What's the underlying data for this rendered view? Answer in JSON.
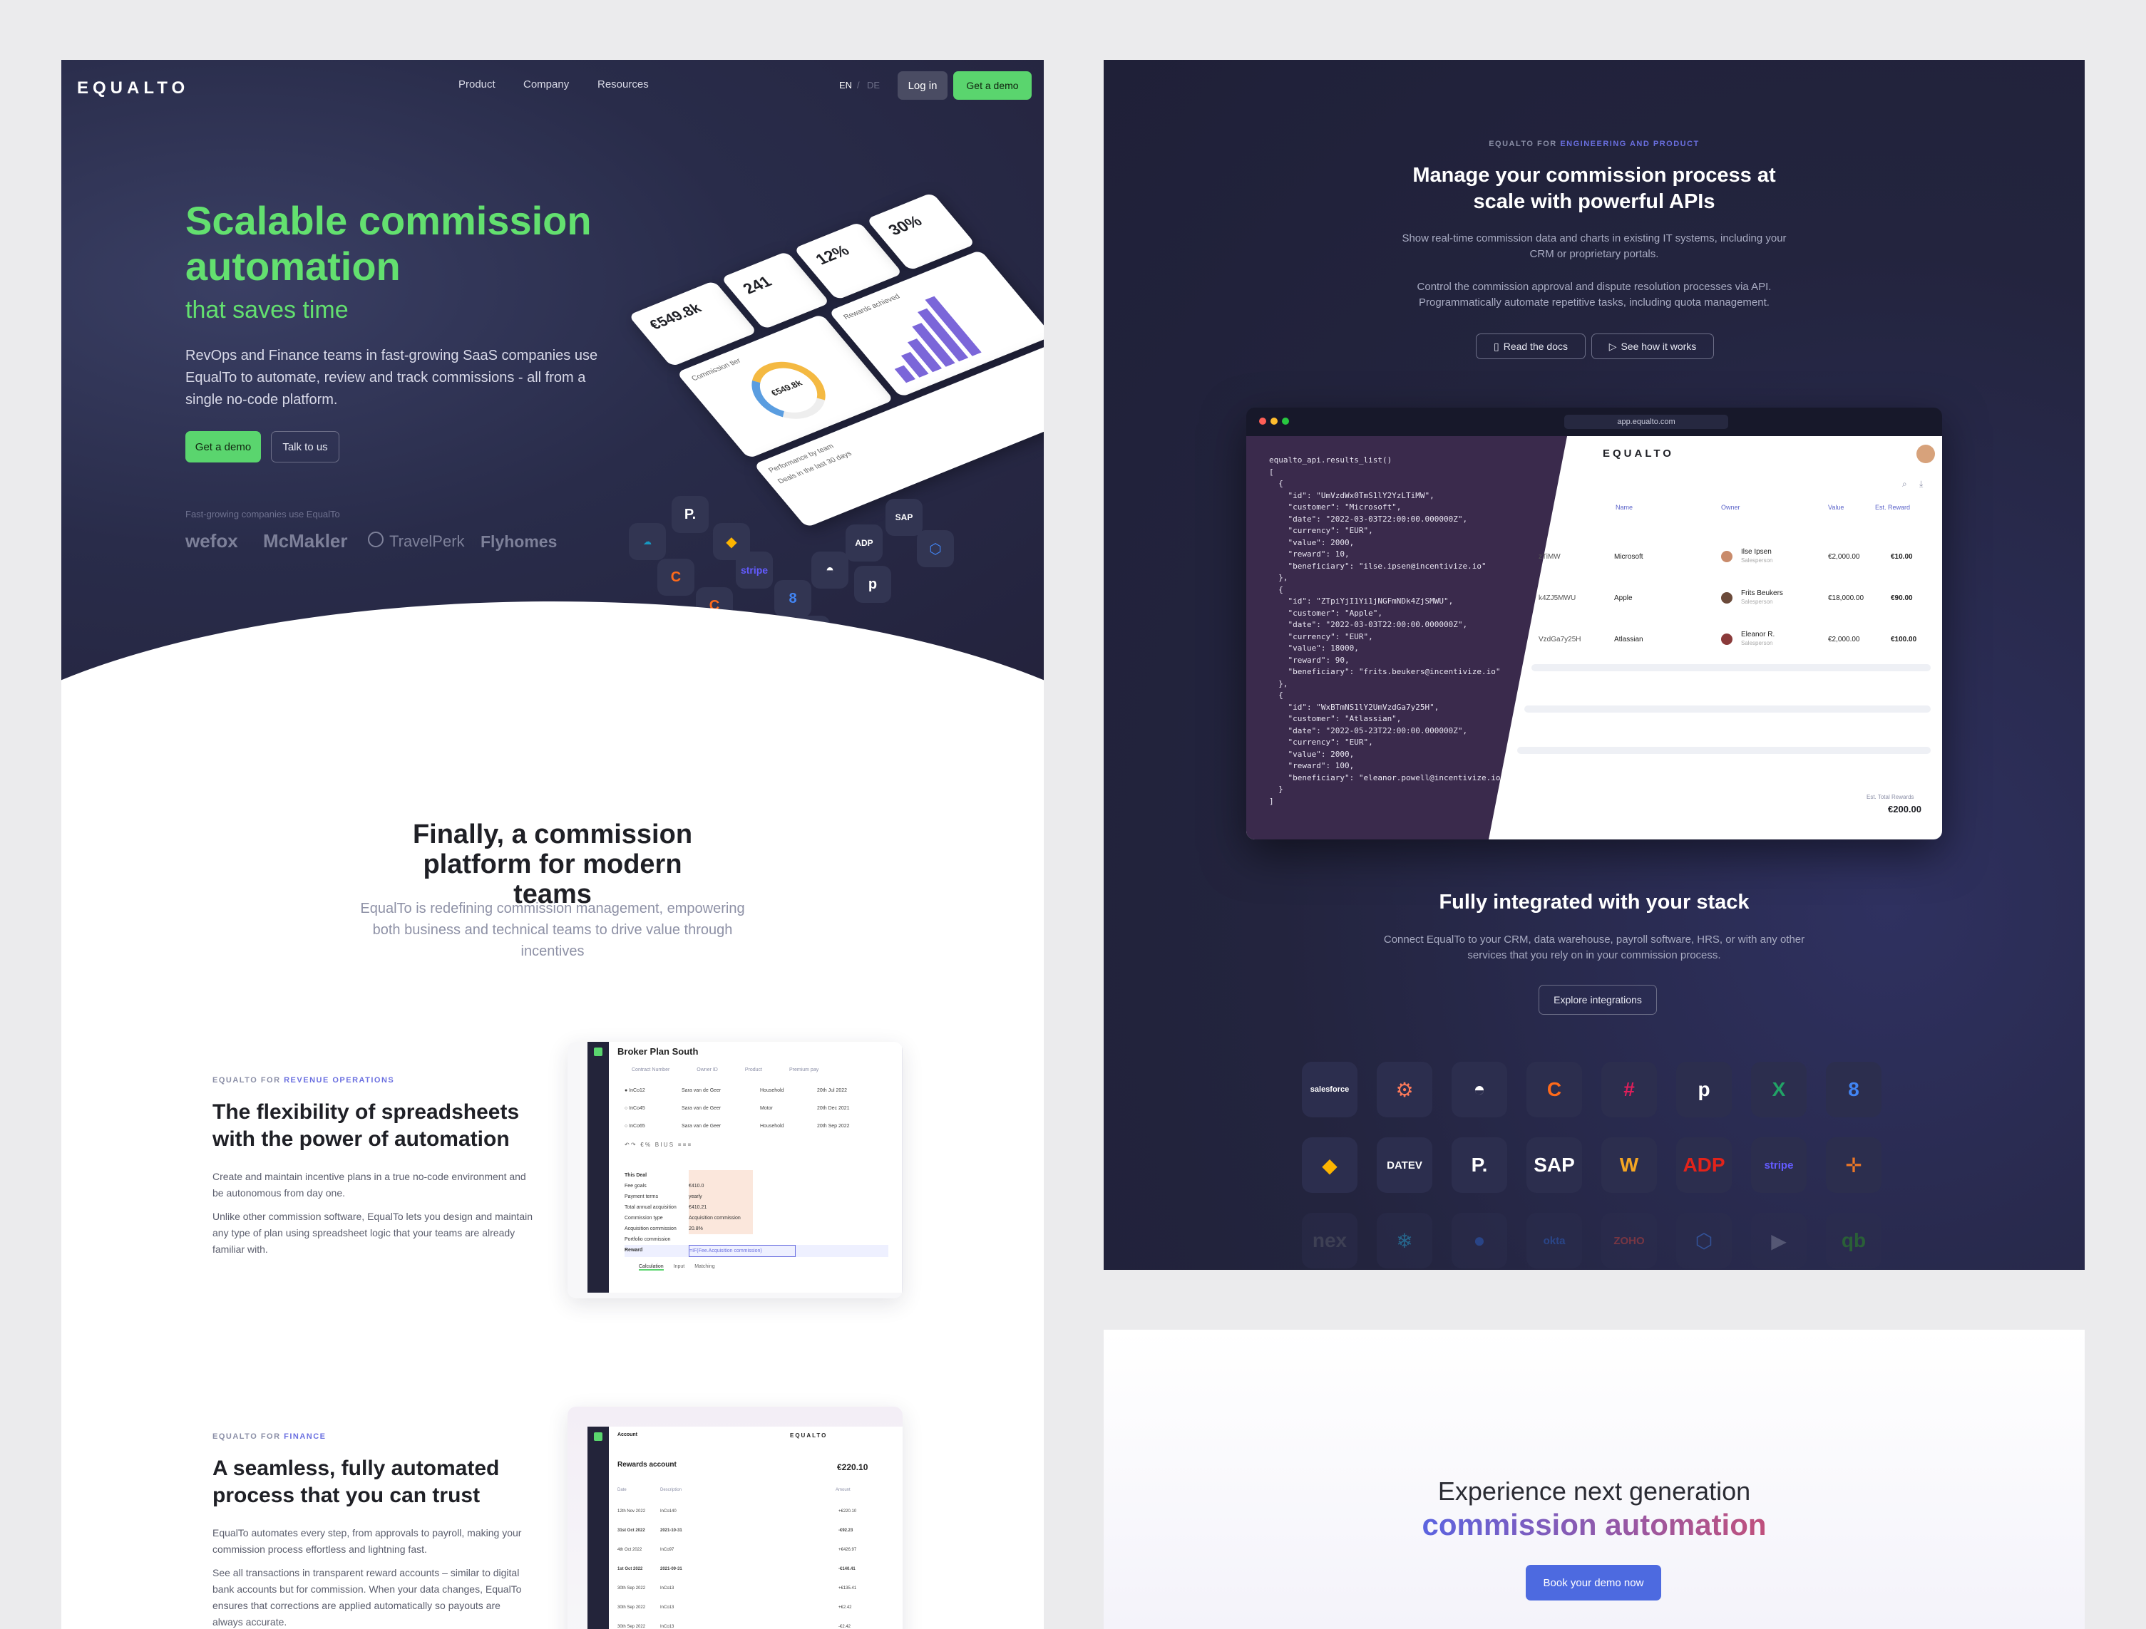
{
  "colors": {
    "accent_green": "#5ad56e",
    "hero_bg": "#292c4a",
    "purple": "#6a6fe0"
  },
  "nav": {
    "logo": "EQUALTO",
    "links": [
      "Product",
      "Company",
      "Resources"
    ],
    "lang_en": "EN",
    "lang_sep": "/",
    "lang_de": "DE",
    "login": "Log in",
    "demo": "Get a demo"
  },
  "hero": {
    "title": "Scalable commission automation",
    "subtitle": "that saves time",
    "description": "RevOps and Finance teams in fast-growing SaaS companies use EqualTo to automate, review and track commissions - all from a single no-code platform.",
    "cta_primary": "Get a demo",
    "cta_secondary": "Talk to us",
    "logos_label": "Fast-growing companies use EqualTo",
    "logos": [
      "wefox",
      "McMakler",
      "TravelPerk",
      "Flyhomes"
    ]
  },
  "dashboard": {
    "stat1": "€549.8k",
    "stat2": "241",
    "stat3": "12%",
    "stat4": "30%",
    "gauge_value": "€549.8k",
    "label_commission": "Commission tier",
    "label_rewards": "Rewards achieved",
    "label_deals": "Deals in the last 30 days",
    "label_performance": "Performance by team"
  },
  "modern": {
    "title": "Finally, a commission platform for modern teams",
    "text": "EqualTo is redefining commission management, empowering both business and technical teams to drive value through incentives"
  },
  "revops": {
    "eyebrow_prefix": "EQUALTO FOR",
    "eyebrow_highlight": "REVENUE OPERATIONS",
    "title": "The flexibility of spreadsheets with the power of automation",
    "p1": "Create and maintain incentive plans in a true no-code environment and be autonomous from day one.",
    "p2": "Unlike other commission software, EqualTo lets you design and maintain any type of plan using spreadsheet logic that your teams are already familiar with.",
    "shot_title": "Broker Plan South",
    "shot_cols": [
      "Contract Number",
      "Owner ID",
      "Product",
      "Premium pay"
    ],
    "shot_rows": [
      [
        "InCo12",
        "Sara van de Geer",
        "Household",
        "20th Jul 2022"
      ],
      [
        "InCo45",
        "Sara van de Geer",
        "Motor",
        "20th Dec 2021"
      ],
      [
        "InCo65",
        "Sara van de Geer",
        "Household",
        "20th Sep 2022"
      ]
    ],
    "sheet_rows": [
      "This Deal",
      "Fee goals",
      "Payment terms",
      "Total annual acquisition",
      "Commission type",
      "Acquisition commission",
      "Portfolio commission",
      "Reward"
    ],
    "sheet_vals": [
      "",
      "€410.0",
      "yearly",
      "€410.21",
      "Acquisition commission",
      "20.8%",
      "",
      "=IF(Fee.Acquisition commission)"
    ],
    "sheet_tabs": [
      "Calculation",
      "Input",
      "Matching"
    ]
  },
  "finance": {
    "eyebrow_prefix": "EQUALTO FOR",
    "eyebrow_highlight": "FINANCE",
    "title": "A seamless, fully automated process that you can trust",
    "p1": "EqualTo automates every step, from approvals to payroll, making your commission process effortless and lightning fast.",
    "p2": "See all transactions in transparent reward accounts – similar to digital bank accounts but for commission. When your data changes, EqualTo ensures that corrections are applied automatically so payouts are always accurate.",
    "shot_header": "Account",
    "shot_title": "Rewards account",
    "shot_total": "€220.10",
    "shot_cols": [
      "Date",
      "Description",
      "Amount"
    ],
    "shot_rows": [
      [
        "12th Nov 2022",
        "InCo140",
        "+€220.10"
      ],
      [
        "31st Oct 2022",
        "2021-10-31",
        "-€92.23"
      ],
      [
        "4th Oct 2022",
        "InCo97",
        "+€426.97"
      ],
      [
        "1st Oct 2022",
        "2021-09-31",
        "-€140.41"
      ],
      [
        "30th Sep 2022",
        "InCo13",
        "+€135.41"
      ],
      [
        "30th Sep 2022",
        "InCo13",
        "+€2.42"
      ],
      [
        "30th Sep 2022",
        "InCo13",
        "-€2.42"
      ]
    ]
  },
  "api": {
    "eyebrow_prefix": "EQUALTO FOR",
    "eyebrow_highlight": "ENGINEERING AND PRODUCT",
    "title": "Manage your commission process at scale with powerful APIs",
    "p1": "Show real-time commission data and charts in existing IT systems, including your CRM or proprietary portals.",
    "p2": "Control the commission approval and dispute resolution processes via API. Programmatically automate repetitive tasks, including quota management.",
    "btn_docs": "Read the docs",
    "btn_how": "See how it works",
    "url": "app.equalto.com",
    "code": "equalto_api.results_list()\n[\n  {\n    \"id\": \"UmVzdWx0TmS1lY2YzLTiMW\",\n    \"customer\": \"Microsoft\",\n    \"date\": \"2022-03-03T22:00:00.000000Z\",\n    \"currency\": \"EUR\",\n    \"value\": 2000,\n    \"reward\": 10,\n    \"beneficiary\": \"ilse.ipsen@incentivize.io\"\n  },\n  {\n    \"id\": \"ZTpiYjI1Yi1jNGFmNDk4ZjSMWU\",\n    \"customer\": \"Apple\",\n    \"date\": \"2022-03-03T22:00:00.000000Z\",\n    \"currency\": \"EUR\",\n    \"value\": 18000,\n    \"reward\": 90,\n    \"beneficiary\": \"frits.beukers@incentivize.io\"\n  },\n  {\n    \"id\": \"WxBTmNS1lY2UmVzdGa7y25H\",\n    \"customer\": \"Atlassian\",\n    \"date\": \"2022-05-23T22:00:00.000000Z\",\n    \"currency\": \"EUR\",\n    \"value\": 2000,\n    \"reward\": 100,\n    \"beneficiary\": \"eleanor.powell@incentivize.io\"\n  }\n]",
    "table_cols": [
      "Name",
      "Owner",
      "Value",
      "Est. Reward"
    ],
    "table_rows": [
      [
        "zTiMW",
        "Microsoft",
        "Ilse Ipsen",
        "Salesperson",
        "€2,000.00",
        "€10.00"
      ],
      [
        "k4ZJ5MWU",
        "Apple",
        "Frits Beukers",
        "Salesperson",
        "€18,000.00",
        "€90.00"
      ],
      [
        "VzdGa7y25H",
        "Atlassian",
        "Eleanor R.",
        "Salesperson",
        "€2,000.00",
        "€100.00"
      ]
    ],
    "total_label": "Est. Total Rewards",
    "total_value": "€200.00"
  },
  "integrations": {
    "title": "Fully integrated with your stack",
    "text": "Connect EqualTo to your CRM, data warehouse, payroll software, HRS, or with any other services that you rely on in your commission process.",
    "button": "Explore integrations",
    "row1": [
      {
        "icon": "salesforce-icon",
        "label": "salesforce",
        "color": "#1798c1"
      },
      {
        "icon": "hubspot-icon",
        "label": "⚙",
        "color": "#ff7a59"
      },
      {
        "icon": "hat-icon",
        "label": "◓",
        "color": "#ffffff"
      },
      {
        "icon": "chargebee-icon",
        "label": "C",
        "color": "#ff6a1a"
      },
      {
        "icon": "slack-icon",
        "label": "#",
        "color": "#e01e5a"
      },
      {
        "icon": "pipedrive-icon",
        "label": "p",
        "color": "#ffffff"
      },
      {
        "icon": "excel-icon",
        "label": "X",
        "color": "#21a366"
      },
      {
        "icon": "looker-icon",
        "label": "8",
        "color": "#4285f4"
      }
    ],
    "row2": [
      {
        "icon": "airtable-icon",
        "label": "◆",
        "color": "#fcb400"
      },
      {
        "icon": "datev-icon",
        "label": "DATEV",
        "color": "#ffffff"
      },
      {
        "icon": "signature-icon",
        "label": "P.",
        "color": "#ffffff"
      },
      {
        "icon": "sap-icon",
        "label": "SAP",
        "color": "#ffffff"
      },
      {
        "icon": "workday-icon",
        "label": "W",
        "color": "#f5a623"
      },
      {
        "icon": "adp-icon",
        "label": "ADP",
        "color": "#e2231a"
      },
      {
        "icon": "stripe-icon",
        "label": "stripe",
        "color": "#635bff"
      },
      {
        "icon": "tableau-icon",
        "label": "✛",
        "color": "#e97627"
      }
    ],
    "row3": [
      {
        "icon": "netsuite-icon",
        "label": "nex",
        "color": "#5f6270"
      },
      {
        "icon": "snowflake-icon",
        "label": "❄",
        "color": "#29b5e8"
      },
      {
        "icon": "zoho-icon",
        "label": "●",
        "color": "#2f6ad8"
      },
      {
        "icon": "okta-icon",
        "label": "okta",
        "color": "#2f6ad8"
      },
      {
        "icon": "zoho-books-icon",
        "label": "ZOHO",
        "color": "#d8473c"
      },
      {
        "icon": "gcp-icon",
        "label": "⬡",
        "color": "#4285f4"
      },
      {
        "icon": "dynamics-icon",
        "label": "▶",
        "color": "#8c8fa3"
      },
      {
        "icon": "quickbooks-icon",
        "label": "qb",
        "color": "#2ca01c"
      }
    ]
  },
  "cta": {
    "line1": "Experience next generation",
    "line2": "commission automation",
    "button": "Book your demo now"
  }
}
